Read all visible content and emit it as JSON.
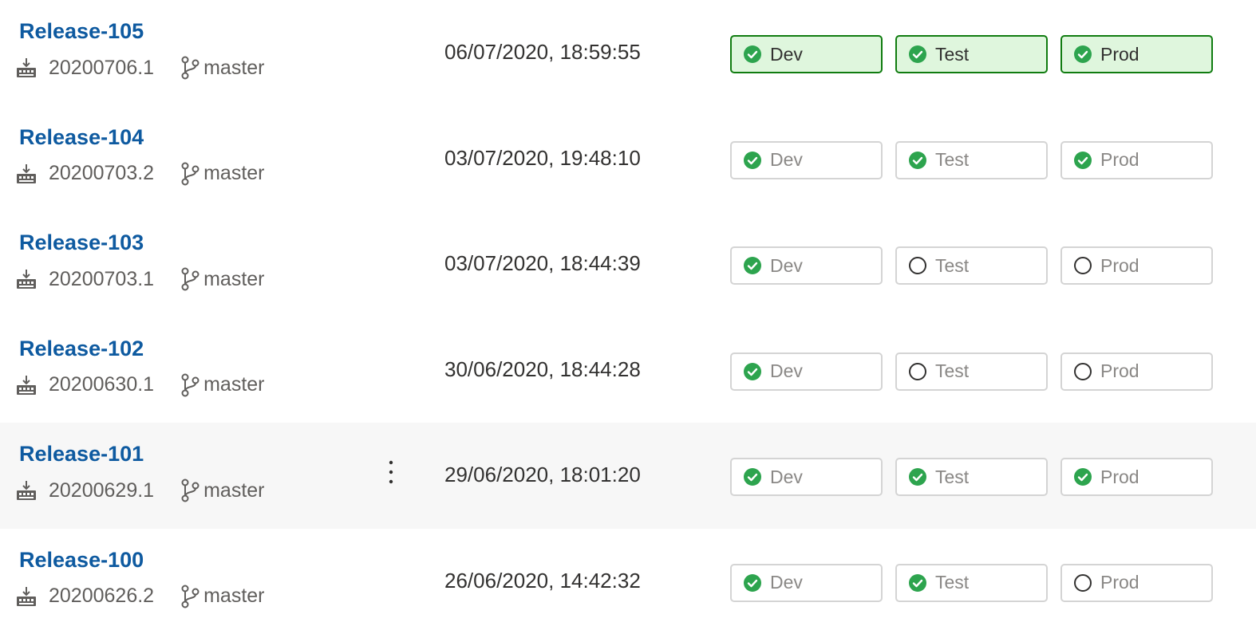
{
  "colors": {
    "link": "#0e5aa0",
    "success": "#2da44e",
    "active_border": "#107c10",
    "active_bg": "#dff6dd",
    "row_hover_bg": "#f7f7f7"
  },
  "releases": [
    {
      "name": "Release-105",
      "build": "20200706.1",
      "branch": "master",
      "date": "06/07/2020, 18:59:55",
      "active": true,
      "hover": false,
      "stages": [
        {
          "label": "Dev",
          "status": "succeeded"
        },
        {
          "label": "Test",
          "status": "succeeded"
        },
        {
          "label": "Prod",
          "status": "succeeded"
        }
      ]
    },
    {
      "name": "Release-104",
      "build": "20200703.2",
      "branch": "master",
      "date": "03/07/2020, 19:48:10",
      "active": false,
      "hover": false,
      "stages": [
        {
          "label": "Dev",
          "status": "succeeded"
        },
        {
          "label": "Test",
          "status": "succeeded"
        },
        {
          "label": "Prod",
          "status": "succeeded"
        }
      ]
    },
    {
      "name": "Release-103",
      "build": "20200703.1",
      "branch": "master",
      "date": "03/07/2020, 18:44:39",
      "active": false,
      "hover": false,
      "stages": [
        {
          "label": "Dev",
          "status": "succeeded"
        },
        {
          "label": "Test",
          "status": "not-deployed"
        },
        {
          "label": "Prod",
          "status": "not-deployed"
        }
      ]
    },
    {
      "name": "Release-102",
      "build": "20200630.1",
      "branch": "master",
      "date": "30/06/2020, 18:44:28",
      "active": false,
      "hover": false,
      "stages": [
        {
          "label": "Dev",
          "status": "succeeded"
        },
        {
          "label": "Test",
          "status": "not-deployed"
        },
        {
          "label": "Prod",
          "status": "not-deployed"
        }
      ]
    },
    {
      "name": "Release-101",
      "build": "20200629.1",
      "branch": "master",
      "date": "29/06/2020, 18:01:20",
      "active": false,
      "hover": true,
      "stages": [
        {
          "label": "Dev",
          "status": "succeeded"
        },
        {
          "label": "Test",
          "status": "succeeded"
        },
        {
          "label": "Prod",
          "status": "succeeded"
        }
      ]
    },
    {
      "name": "Release-100",
      "build": "20200626.2",
      "branch": "master",
      "date": "26/06/2020, 14:42:32",
      "active": false,
      "hover": false,
      "stages": [
        {
          "label": "Dev",
          "status": "succeeded"
        },
        {
          "label": "Test",
          "status": "succeeded"
        },
        {
          "label": "Prod",
          "status": "not-deployed"
        }
      ]
    }
  ]
}
